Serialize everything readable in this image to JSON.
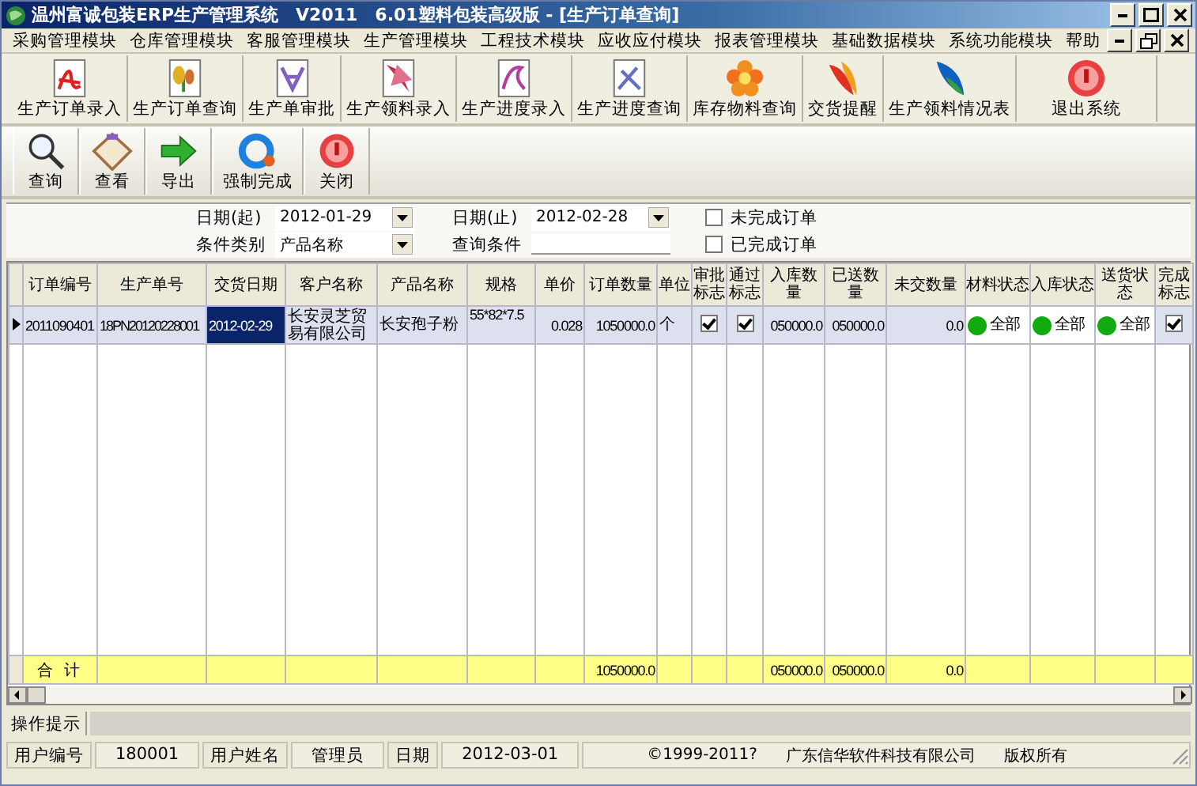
{
  "window": {
    "title": "温州富诚包装ERP生产管理系统　V2011　6.01塑料包装高级版 - [生产订单查询]"
  },
  "menu": [
    "采购管理模块",
    "仓库管理模块",
    "客服管理模块",
    "生产管理模块",
    "工程技术模块",
    "应收应付模块",
    "报表管理模块",
    "基础数据模块",
    "系统功能模块",
    "帮助"
  ],
  "main_toolbar": [
    {
      "label": "生产订单录入"
    },
    {
      "label": "生产订单查询"
    },
    {
      "label": "生产单审批"
    },
    {
      "label": "生产领料录入"
    },
    {
      "label": "生产进度录入"
    },
    {
      "label": "生产进度查询"
    },
    {
      "label": "库存物料查询"
    },
    {
      "label": "交货提醒"
    },
    {
      "label": "生产领料情况表"
    },
    {
      "label": "退出系统"
    }
  ],
  "action_toolbar": [
    {
      "label": "查询"
    },
    {
      "label": "查看"
    },
    {
      "label": "导出"
    },
    {
      "label": "强制完成"
    },
    {
      "label": "关闭"
    }
  ],
  "filters": {
    "date_from": {
      "label": "日期(起)",
      "value": "2012-01-29"
    },
    "date_to": {
      "label": "日期(止)",
      "value": "2012-02-28"
    },
    "condition_type": {
      "label": "条件类别",
      "value": "产品名称"
    },
    "condition": {
      "label": "查询条件"
    },
    "checkboxes": [
      {
        "label": "未完成订单",
        "checked": false
      },
      {
        "label": "已完成订单",
        "checked": false
      }
    ]
  },
  "table": {
    "columns": [
      "订单编号",
      "生产单号",
      "交货日期",
      "客户名称",
      "产品名称",
      "规格",
      "单价",
      "订单数量",
      "单位",
      "审批标志",
      "通过标志",
      "入库数量",
      "已送数量",
      "未交数量",
      "材料状态",
      "入库状态",
      "送货状态",
      "完成标志"
    ],
    "rows": [
      {
        "selected": true,
        "cells": [
          {
            "kind": "text",
            "text": "2011090401",
            "selected": false
          },
          {
            "kind": "text",
            "text": "18PN20120228001",
            "selected": false
          },
          {
            "kind": "text",
            "text": "2012-02-29",
            "selected": true
          },
          {
            "kind": "text",
            "text": "长安灵芝贸易有限公司",
            "selected": false
          },
          {
            "kind": "text",
            "text": "长安孢子粉",
            "selected": false
          },
          {
            "kind": "text",
            "text": "55*82*7.5",
            "selected": false
          },
          {
            "kind": "text",
            "text": "0.028",
            "selected": false
          },
          {
            "kind": "text",
            "text": "1050000.0",
            "selected": false
          },
          {
            "kind": "text",
            "text": "个",
            "selected": false
          },
          {
            "kind": "check",
            "checked": true
          },
          {
            "kind": "check",
            "checked": true
          },
          {
            "kind": "text",
            "text": "050000.0",
            "selected": false
          },
          {
            "kind": "text",
            "text": "050000.0",
            "selected": false
          },
          {
            "kind": "text",
            "text": "0.0",
            "selected": false
          },
          {
            "kind": "status",
            "text": "全部",
            "color": "#11aa11"
          },
          {
            "kind": "status",
            "text": "全部",
            "color": "#11aa11"
          },
          {
            "kind": "status",
            "text": "全部",
            "color": "#11aa11"
          },
          {
            "kind": "check",
            "checked": true
          }
        ]
      }
    ],
    "totals": {
      "label": "合 计",
      "order_quantity": "1050000.0",
      "stocked_quantity": "050000.0",
      "delivered_quantity": "050000.0",
      "outstanding_quantity": "0.0"
    }
  },
  "hint_bar": {
    "label": "操作提示"
  },
  "status_bar": {
    "fields": [
      {
        "label": "用户编号",
        "value": "180001"
      },
      {
        "label": "用户姓名",
        "value": "管理员"
      },
      {
        "label": "日期",
        "value": "2012-03-01"
      }
    ],
    "notes": [
      "©1999-2011?",
      "广东信华软件科技有限公司",
      "版权所有"
    ]
  }
}
